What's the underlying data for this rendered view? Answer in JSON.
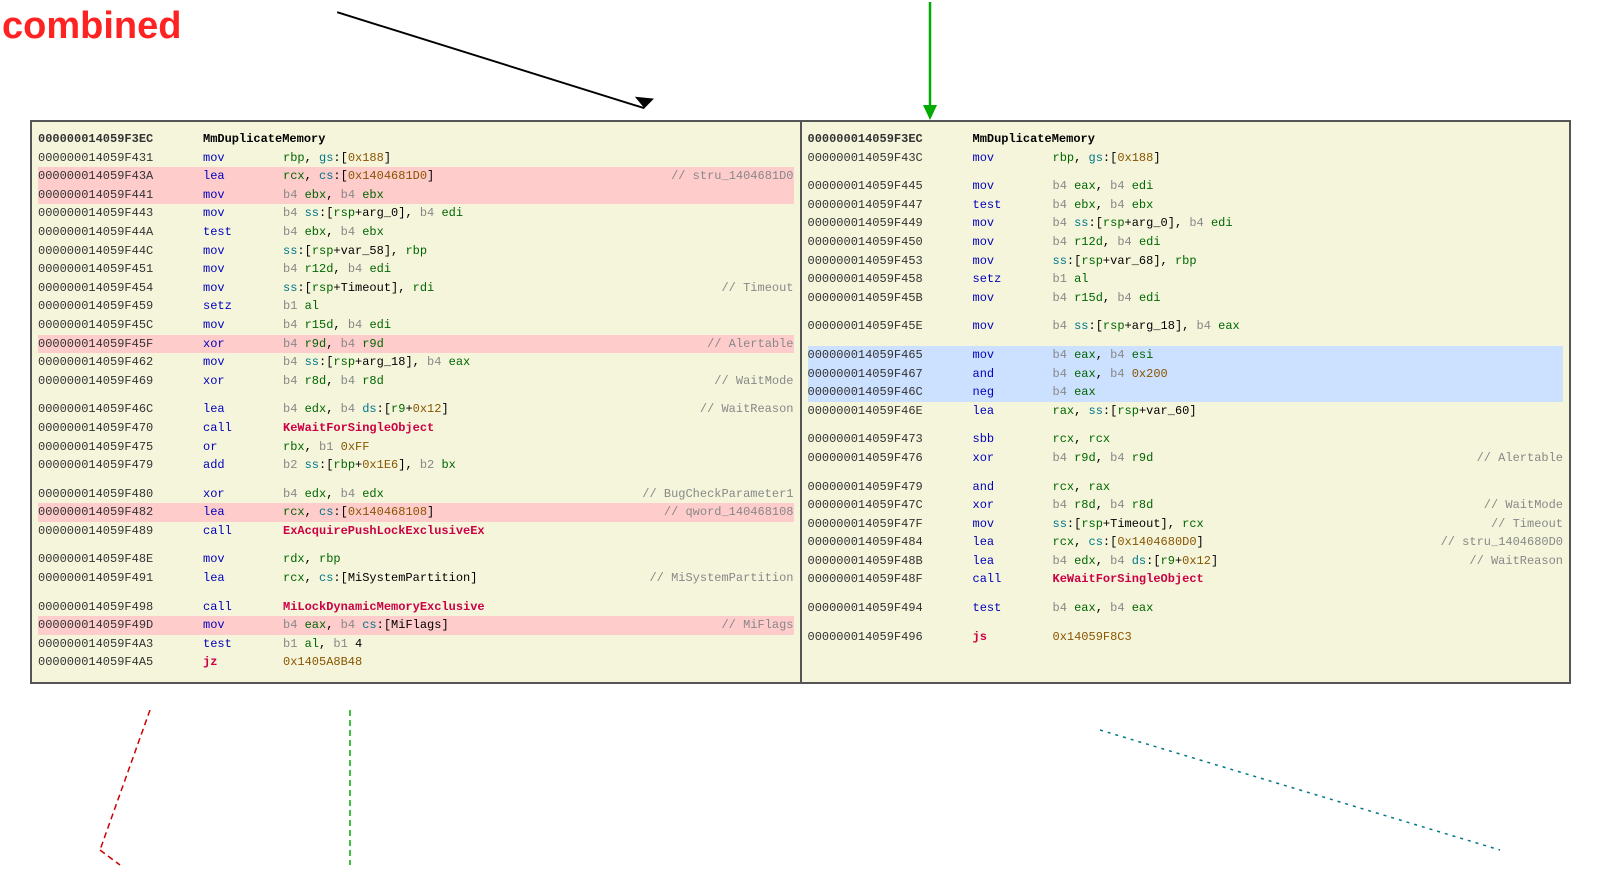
{
  "title": "combined",
  "colors": {
    "title": "#ff2222",
    "accent_green": "#00aa00",
    "accent_black": "#000000",
    "panel_bg": "#f5f5dc",
    "pink_highlight": "#ffcccc",
    "blue_highlight": "#cce0ff"
  },
  "left_panel": {
    "header": {
      "addr": "000000014059F3EC",
      "name": "MmDuplicateMemory"
    },
    "rows": [
      {
        "addr": "000000014059F431",
        "mnem": "mov",
        "ops": "rbp, gs:[0x188]",
        "comment": "",
        "hl": ""
      },
      {
        "addr": "000000014059F43A",
        "mnem": "lea",
        "ops": "rcx, cs:[0x1404681D0]",
        "comment": "// stru_1404681D0",
        "hl": "pink"
      },
      {
        "addr": "000000014059F441",
        "mnem": "mov",
        "ops": "b4 ebx, b4 ebx",
        "comment": "",
        "hl": "pink"
      },
      {
        "addr": "000000014059F443",
        "mnem": "mov",
        "ops": "b4 ss:[rsp+arg_0], b4 edi",
        "comment": "",
        "hl": ""
      },
      {
        "addr": "000000014059F44A",
        "mnem": "test",
        "ops": "b4 ebx, b4 ebx",
        "comment": "",
        "hl": ""
      },
      {
        "addr": "000000014059F44C",
        "mnem": "mov",
        "ops": "ss:[rsp+var_58], rbp",
        "comment": "",
        "hl": ""
      },
      {
        "addr": "000000014059F451",
        "mnem": "mov",
        "ops": "b4 r12d, b4 edi",
        "comment": "",
        "hl": ""
      },
      {
        "addr": "000000014059F454",
        "mnem": "mov",
        "ops": "ss:[rsp+Timeout], rdi",
        "comment": "// Timeout",
        "hl": ""
      },
      {
        "addr": "000000014059F459",
        "mnem": "setz",
        "ops": "b1 al",
        "comment": "",
        "hl": ""
      },
      {
        "addr": "000000014059F45C",
        "mnem": "mov",
        "ops": "b4 r15d, b4 edi",
        "comment": "",
        "hl": ""
      },
      {
        "addr": "000000014059F45F",
        "mnem": "xor",
        "ops": "b4 r9d, b4 r9d",
        "comment": "// Alertable",
        "hl": "pink"
      },
      {
        "addr": "000000014059F462",
        "mnem": "mov",
        "ops": "b4 ss:[rsp+arg_18], b4 eax",
        "comment": "",
        "hl": ""
      },
      {
        "addr": "000000014059F469",
        "mnem": "xor",
        "ops": "b4 r8d, b4 r8d",
        "comment": "// WaitMode",
        "hl": ""
      },
      {
        "addr": "",
        "mnem": "",
        "ops": "",
        "comment": "",
        "hl": "blank"
      },
      {
        "addr": "000000014059F46C",
        "mnem": "lea",
        "ops": "b4 edx, b4 ds:[r9+0x12]",
        "comment": "// WaitReason",
        "hl": ""
      },
      {
        "addr": "000000014059F470",
        "mnem": "call",
        "ops": "KeWaitForSingleObject",
        "comment": "",
        "hl": ""
      },
      {
        "addr": "000000014059F475",
        "mnem": "or",
        "ops": "rbx, b1 0xFF",
        "comment": "",
        "hl": ""
      },
      {
        "addr": "000000014059F479",
        "mnem": "add",
        "ops": "b2 ss:[rbp+0x1E6], b2 bx",
        "comment": "",
        "hl": ""
      },
      {
        "addr": "",
        "mnem": "",
        "ops": "",
        "comment": "",
        "hl": "blank"
      },
      {
        "addr": "000000014059F480",
        "mnem": "xor",
        "ops": "b4 edx, b4 edx",
        "comment": "// BugCheckParameter1",
        "hl": ""
      },
      {
        "addr": "000000014059F482",
        "mnem": "lea",
        "ops": "rcx, cs:[0x140468108]",
        "comment": "// qword_140468108",
        "hl": "pink"
      },
      {
        "addr": "000000014059F489",
        "mnem": "call",
        "ops": "ExAcquirePushLockExclusiveEx",
        "comment": "",
        "hl": ""
      },
      {
        "addr": "",
        "mnem": "",
        "ops": "",
        "comment": "",
        "hl": "blank"
      },
      {
        "addr": "000000014059F48E",
        "mnem": "mov",
        "ops": "rdx, rbp",
        "comment": "",
        "hl": ""
      },
      {
        "addr": "000000014059F491",
        "mnem": "lea",
        "ops": "rcx, cs:[MiSystemPartition]",
        "comment": "// MiSystemPartition",
        "hl": ""
      },
      {
        "addr": "",
        "mnem": "",
        "ops": "",
        "comment": "",
        "hl": "blank"
      },
      {
        "addr": "000000014059F498",
        "mnem": "call",
        "ops": "MiLockDynamicMemoryExclusive",
        "comment": "",
        "hl": ""
      },
      {
        "addr": "000000014059F49D",
        "mnem": "mov",
        "ops": "b4 eax, b4 cs:[MiFlags]",
        "comment": "// MiFlags",
        "hl": "pink"
      },
      {
        "addr": "000000014059F4A3",
        "mnem": "test",
        "ops": "b1 al, b1 4",
        "comment": "",
        "hl": ""
      },
      {
        "addr": "000000014059F4A5",
        "mnem": "jz",
        "ops": "0x1405A8B48",
        "comment": "",
        "hl": ""
      }
    ]
  },
  "right_panel": {
    "header": {
      "addr": "000000014059F3EC",
      "name": "MmDuplicateMemory"
    },
    "rows": [
      {
        "addr": "000000014059F43C",
        "mnem": "mov",
        "ops": "rbp, gs:[0x188]",
        "comment": "",
        "hl": ""
      },
      {
        "addr": "",
        "mnem": "",
        "ops": "",
        "comment": "",
        "hl": "blank"
      },
      {
        "addr": "000000014059F445",
        "mnem": "mov",
        "ops": "b4 eax, b4 edi",
        "comment": "",
        "hl": ""
      },
      {
        "addr": "000000014059F447",
        "mnem": "test",
        "ops": "b4 ebx, b4 ebx",
        "comment": "",
        "hl": ""
      },
      {
        "addr": "000000014059F449",
        "mnem": "mov",
        "ops": "b4 ss:[rsp+arg_0], b4 edi",
        "comment": "",
        "hl": ""
      },
      {
        "addr": "000000014059F450",
        "mnem": "mov",
        "ops": "b4 r12d, b4 edi",
        "comment": "",
        "hl": ""
      },
      {
        "addr": "000000014059F453",
        "mnem": "mov",
        "ops": "ss:[rsp+var_68], rbp",
        "comment": "",
        "hl": ""
      },
      {
        "addr": "000000014059F458",
        "mnem": "setz",
        "ops": "b1 al",
        "comment": "",
        "hl": ""
      },
      {
        "addr": "000000014059F45B",
        "mnem": "mov",
        "ops": "b4 r15d, b4 edi",
        "comment": "",
        "hl": ""
      },
      {
        "addr": "",
        "mnem": "",
        "ops": "",
        "comment": "",
        "hl": "blank"
      },
      {
        "addr": "000000014059F45E",
        "mnem": "mov",
        "ops": "b4 ss:[rsp+arg_18], b4 eax",
        "comment": "",
        "hl": ""
      },
      {
        "addr": "",
        "mnem": "",
        "ops": "",
        "comment": "",
        "hl": "blank"
      },
      {
        "addr": "000000014059F465",
        "mnem": "mov",
        "ops": "b4 eax, b4 esi",
        "comment": "",
        "hl": "blue"
      },
      {
        "addr": "000000014059F467",
        "mnem": "and",
        "ops": "b4 eax, b4 0x200",
        "comment": "",
        "hl": "blue"
      },
      {
        "addr": "000000014059F46C",
        "mnem": "neg",
        "ops": "b4 eax",
        "comment": "",
        "hl": "blue"
      },
      {
        "addr": "000000014059F46E",
        "mnem": "lea",
        "ops": "rax, ss:[rsp+var_60]",
        "comment": "",
        "hl": ""
      },
      {
        "addr": "",
        "mnem": "",
        "ops": "",
        "comment": "",
        "hl": "blank"
      },
      {
        "addr": "000000014059F473",
        "mnem": "sbb",
        "ops": "rcx, rcx",
        "comment": "",
        "hl": ""
      },
      {
        "addr": "000000014059F476",
        "mnem": "xor",
        "ops": "b4 r9d, b4 r9d",
        "comment": "// Alertable",
        "hl": ""
      },
      {
        "addr": "",
        "mnem": "",
        "ops": "",
        "comment": "",
        "hl": "blank"
      },
      {
        "addr": "000000014059F479",
        "mnem": "and",
        "ops": "rcx, rax",
        "comment": "",
        "hl": ""
      },
      {
        "addr": "000000014059F47C",
        "mnem": "xor",
        "ops": "b4 r8d, b4 r8d",
        "comment": "// WaitMode",
        "hl": ""
      },
      {
        "addr": "000000014059F47F",
        "mnem": "mov",
        "ops": "ss:[rsp+Timeout], rcx",
        "comment": "// Timeout",
        "hl": ""
      },
      {
        "addr": "000000014059F484",
        "mnem": "lea",
        "ops": "rcx, cs:[0x1404680D0]",
        "comment": "// stru_1404680D0",
        "hl": ""
      },
      {
        "addr": "000000014059F48B",
        "mnem": "lea",
        "ops": "b4 edx, b4 ds:[r9+0x12]",
        "comment": "// WaitReason",
        "hl": ""
      },
      {
        "addr": "000000014059F48F",
        "mnem": "call",
        "ops": "KeWaitForSingleObject",
        "comment": "",
        "hl": ""
      },
      {
        "addr": "",
        "mnem": "",
        "ops": "",
        "comment": "",
        "hl": "blank"
      },
      {
        "addr": "000000014059F494",
        "mnem": "test",
        "ops": "b4 eax, b4 eax",
        "comment": "",
        "hl": ""
      },
      {
        "addr": "",
        "mnem": "",
        "ops": "",
        "comment": "",
        "hl": "blank"
      },
      {
        "addr": "000000014059F496",
        "mnem": "js",
        "ops": "0x14059F8C3",
        "comment": "",
        "hl": ""
      }
    ]
  }
}
